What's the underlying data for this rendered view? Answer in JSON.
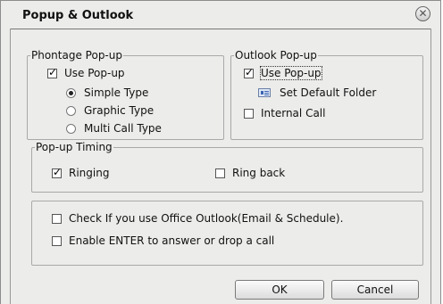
{
  "window": {
    "title": "Popup & Outlook"
  },
  "phontage": {
    "legend": "Phontage Pop-up",
    "use_popup_label": "Use Pop-up",
    "use_popup_checked": true,
    "types": [
      {
        "label": "Simple Type",
        "selected": true
      },
      {
        "label": "Graphic Type",
        "selected": false
      },
      {
        "label": "Multi Call Type",
        "selected": false
      }
    ]
  },
  "outlook": {
    "legend": "Outlook Pop-up",
    "use_popup_label": "Use Pop-up",
    "use_popup_checked": true,
    "set_default_folder_label": "Set Default Folder",
    "internal_call_label": "Internal Call",
    "internal_call_checked": false
  },
  "timing": {
    "legend": "Pop-up Timing",
    "ringing_label": "Ringing",
    "ringing_checked": true,
    "ring_back_label": "Ring back",
    "ring_back_checked": false
  },
  "options": {
    "office_outlook_label": "Check If you use Office Outlook(Email & Schedule).",
    "office_outlook_checked": false,
    "enter_answer_label": "Enable ENTER to answer or drop a call",
    "enter_answer_checked": false
  },
  "buttons": {
    "ok": "OK",
    "cancel": "Cancel"
  }
}
